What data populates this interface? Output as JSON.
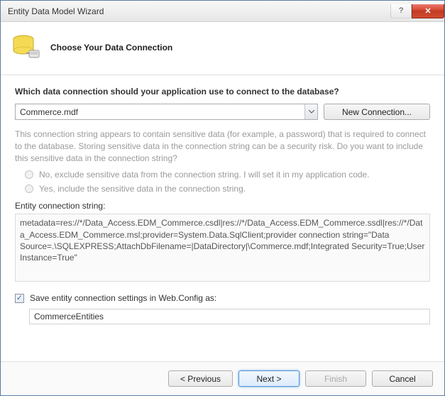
{
  "window": {
    "title": "Entity Data Model Wizard",
    "help_glyph": "?",
    "close_glyph": "✕"
  },
  "header": {
    "title": "Choose Your Data Connection"
  },
  "question": "Which data connection should your application use to connect to the database?",
  "connection": {
    "selected": "Commerce.mdf",
    "new_button": "New Connection..."
  },
  "sensitive_info": "This connection string appears to contain sensitive data (for example, a password) that is required to connect to the database. Storing sensitive data in the connection string can be a security risk. Do you want to include this sensitive data in the connection string?",
  "radios": {
    "exclude": "No, exclude sensitive data from the connection string. I will set it in my application code.",
    "include": "Yes, include the sensitive data in the connection string."
  },
  "conn_string_label": "Entity connection string:",
  "conn_string_value": "metadata=res://*/Data_Access.EDM_Commerce.csdl|res://*/Data_Access.EDM_Commerce.ssdl|res://*/Data_Access.EDM_Commerce.msl;provider=System.Data.SqlClient;provider connection string=\"Data Source=.\\SQLEXPRESS;AttachDbFilename=|DataDirectory|\\Commerce.mdf;Integrated Security=True;User Instance=True\"",
  "save_checkbox_label": "Save entity connection settings in Web.Config as:",
  "save_name": "CommerceEntities",
  "buttons": {
    "previous": "< Previous",
    "next": "Next >",
    "finish": "Finish",
    "cancel": "Cancel"
  }
}
